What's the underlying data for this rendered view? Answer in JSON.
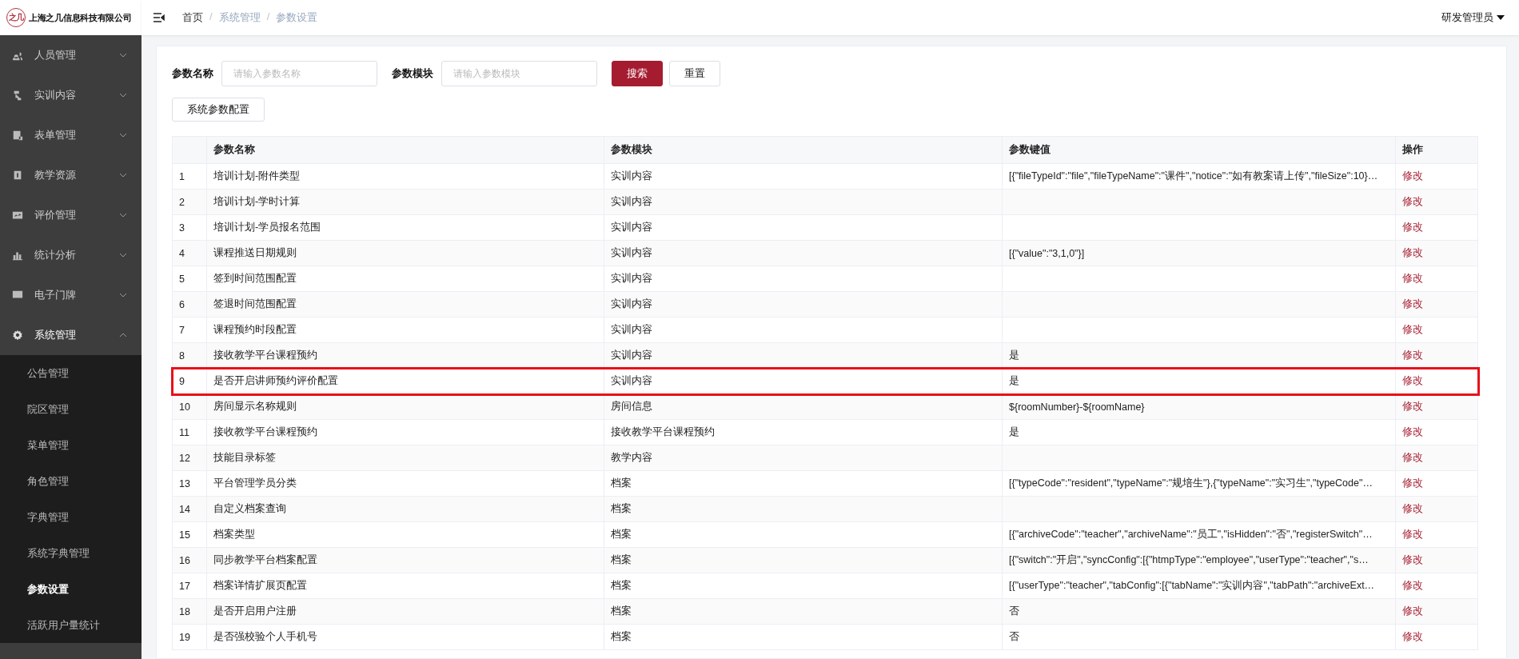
{
  "app": {
    "logo_text": "之几",
    "company": "上海之几信息科技有限公司"
  },
  "header": {
    "breadcrumb": [
      "首页",
      "系统管理",
      "参数设置"
    ],
    "breadcrumb_separator": "/",
    "user": "研发管理员"
  },
  "sidebar": {
    "items": [
      {
        "label": "人员管理",
        "expanded": false
      },
      {
        "label": "实训内容",
        "expanded": false
      },
      {
        "label": "表单管理",
        "expanded": false
      },
      {
        "label": "教学资源",
        "expanded": false
      },
      {
        "label": "评价管理",
        "expanded": false
      },
      {
        "label": "统计分析",
        "expanded": false
      },
      {
        "label": "电子门牌",
        "expanded": false
      },
      {
        "label": "系统管理",
        "expanded": true,
        "children": [
          {
            "label": "公告管理",
            "selected": false
          },
          {
            "label": "院区管理",
            "selected": false
          },
          {
            "label": "菜单管理",
            "selected": false
          },
          {
            "label": "角色管理",
            "selected": false
          },
          {
            "label": "字典管理",
            "selected": false
          },
          {
            "label": "系统字典管理",
            "selected": false
          },
          {
            "label": "参数设置",
            "selected": true
          },
          {
            "label": "活跃用户量统计",
            "selected": false
          }
        ]
      }
    ]
  },
  "search": {
    "fields": [
      {
        "label": "参数名称",
        "placeholder": "请输入参数名称"
      },
      {
        "label": "参数模块",
        "placeholder": "请输入参数模块"
      }
    ],
    "buttons": [
      {
        "label": "搜索",
        "kind": "primary"
      },
      {
        "label": "重置",
        "kind": "default"
      }
    ]
  },
  "toolbar": {
    "button": "系统参数配置"
  },
  "table": {
    "columns": [
      "参数名称",
      "参数模块",
      "参数键值",
      "操作"
    ],
    "rows": [
      {
        "index": "1",
        "name": "培训计划-附件类型",
        "module": "实训内容",
        "value": "[{\"fileTypeId\":\"file\",\"fileTypeName\":\"课件\",\"notice\":\"如有教案请上传\",\"fileSize\":10}…",
        "action": "修改",
        "highlighted": false
      },
      {
        "index": "2",
        "name": "培训计划-学时计算",
        "module": "实训内容",
        "value": "",
        "action": "修改",
        "highlighted": false
      },
      {
        "index": "3",
        "name": "培训计划-学员报名范围",
        "module": "实训内容",
        "value": "",
        "action": "修改",
        "highlighted": false
      },
      {
        "index": "4",
        "name": "课程推送日期规则",
        "module": "实训内容",
        "value": "[{\"value\":\"3,1,0\"}]",
        "action": "修改",
        "highlighted": false
      },
      {
        "index": "5",
        "name": "签到时间范围配置",
        "module": "实训内容",
        "value": "",
        "action": "修改",
        "highlighted": false
      },
      {
        "index": "6",
        "name": "签退时间范围配置",
        "module": "实训内容",
        "value": "",
        "action": "修改",
        "highlighted": false
      },
      {
        "index": "7",
        "name": "课程预约时段配置",
        "module": "实训内容",
        "value": "",
        "action": "修改",
        "highlighted": false
      },
      {
        "index": "8",
        "name": "接收教学平台课程预约",
        "module": "实训内容",
        "value": "是",
        "action": "修改",
        "highlighted": false
      },
      {
        "index": "9",
        "name": "是否开启讲师预约评价配置",
        "module": "实训内容",
        "value": "是",
        "action": "修改",
        "highlighted": true
      },
      {
        "index": "10",
        "name": "房间显示名称规则",
        "module": "房间信息",
        "value": "${roomNumber}-${roomName}",
        "action": "修改",
        "highlighted": false
      },
      {
        "index": "11",
        "name": "接收教学平台课程预约",
        "module": "接收教学平台课程预约",
        "value": "是",
        "action": "修改",
        "highlighted": false
      },
      {
        "index": "12",
        "name": "技能目录标签",
        "module": "教学内容",
        "value": "",
        "action": "修改",
        "highlighted": false
      },
      {
        "index": "13",
        "name": "平台管理学员分类",
        "module": "档案",
        "value": "[{\"typeCode\":\"resident\",\"typeName\":\"规培生\"},{\"typeName\":\"实习生\",\"typeCode\"…",
        "action": "修改",
        "highlighted": false
      },
      {
        "index": "14",
        "name": "自定义档案查询",
        "module": "档案",
        "value": "",
        "action": "修改",
        "highlighted": false
      },
      {
        "index": "15",
        "name": "档案类型",
        "module": "档案",
        "value": "[{\"archiveCode\":\"teacher\",\"archiveName\":\"员工\",\"isHidden\":\"否\",\"registerSwitch\"…",
        "action": "修改",
        "highlighted": false
      },
      {
        "index": "16",
        "name": "同步教学平台档案配置",
        "module": "档案",
        "value": "[{\"switch\":\"开启\",\"syncConfig\":[{\"htmpType\":\"employee\",\"userType\":\"teacher\",\"s…",
        "action": "修改",
        "highlighted": false
      },
      {
        "index": "17",
        "name": "档案详情扩展页配置",
        "module": "档案",
        "value": "[{\"userType\":\"teacher\",\"tabConfig\":[{\"tabName\":\"实训内容\",\"tabPath\":\"archiveExt…",
        "action": "修改",
        "highlighted": false
      },
      {
        "index": "18",
        "name": "是否开启用户注册",
        "module": "档案",
        "value": "否",
        "action": "修改",
        "highlighted": false
      },
      {
        "index": "19",
        "name": "是否强校验个人手机号",
        "module": "档案",
        "value": "否",
        "action": "修改",
        "highlighted": false
      }
    ]
  }
}
